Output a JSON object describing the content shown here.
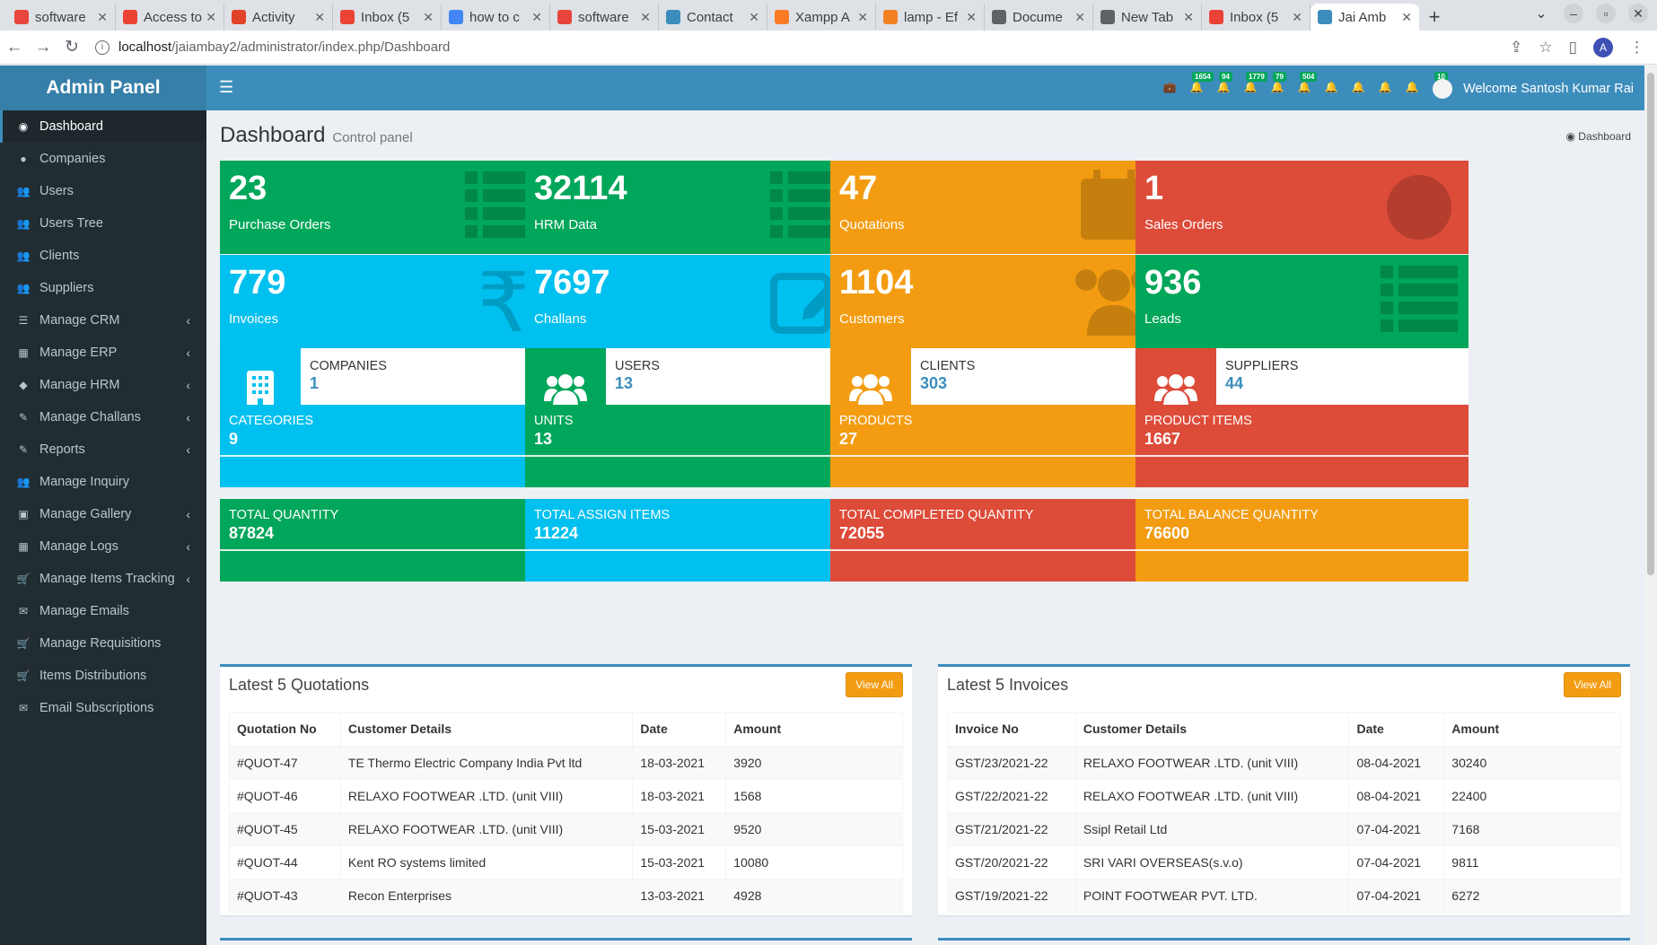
{
  "browser": {
    "tabs": [
      {
        "label": "software",
        "color": "#e8453c"
      },
      {
        "label": "Access to",
        "color": "#ea4335"
      },
      {
        "label": "Activity",
        "color": "#e24329"
      },
      {
        "label": "Inbox (5",
        "color": "#ea4335"
      },
      {
        "label": "how to c",
        "color": "#4285f4"
      },
      {
        "label": "software",
        "color": "#e8453c"
      },
      {
        "label": "Contact",
        "color": "#3c8dbc"
      },
      {
        "label": "Xampp A",
        "color": "#fb7a24"
      },
      {
        "label": "lamp - Ef",
        "color": "#f48024"
      },
      {
        "label": "Docume",
        "color": "#5f6368"
      },
      {
        "label": "New Tab",
        "color": "#5f6368"
      },
      {
        "label": "Inbox (5",
        "color": "#ea4335"
      },
      {
        "label": "Jai Amb",
        "color": "#3c8dbc"
      }
    ],
    "url_host": "localhost",
    "url_path": "/jaiambay2/administrator/index.php/Dashboard",
    "profile_initial": "A"
  },
  "brand": "Admin Panel",
  "sidebar": {
    "items": [
      {
        "label": "Dashboard",
        "icon": "dashboard-icon",
        "glyph": "◉",
        "arrow": ""
      },
      {
        "label": "Companies",
        "icon": "globe-icon",
        "glyph": "●",
        "arrow": ""
      },
      {
        "label": "Users",
        "icon": "users-icon",
        "glyph": "👥",
        "arrow": ""
      },
      {
        "label": "Users Tree",
        "icon": "users-icon",
        "glyph": "👥",
        "arrow": ""
      },
      {
        "label": "Clients",
        "icon": "users-icon",
        "glyph": "👥",
        "arrow": ""
      },
      {
        "label": "Suppliers",
        "icon": "users-icon",
        "glyph": "👥",
        "arrow": ""
      },
      {
        "label": "Manage CRM",
        "icon": "list-icon",
        "glyph": "☰",
        "arrow": "‹"
      },
      {
        "label": "Manage ERP",
        "icon": "film-icon",
        "glyph": "▦",
        "arrow": "‹"
      },
      {
        "label": "Manage HRM",
        "icon": "tags-icon",
        "glyph": "◆",
        "arrow": "‹"
      },
      {
        "label": "Manage Challans",
        "icon": "edit-icon",
        "glyph": "✎",
        "arrow": "‹"
      },
      {
        "label": "Reports",
        "icon": "edit-icon",
        "glyph": "✎",
        "arrow": "‹"
      },
      {
        "label": "Manage Inquiry",
        "icon": "users-icon",
        "glyph": "👥",
        "arrow": ""
      },
      {
        "label": "Manage Gallery",
        "icon": "image-icon",
        "glyph": "▣",
        "arrow": "‹"
      },
      {
        "label": "Manage Logs",
        "icon": "calendar-icon",
        "glyph": "▦",
        "arrow": "‹"
      },
      {
        "label": "Manage Items Tracking",
        "icon": "cart-icon",
        "glyph": "🛒",
        "arrow": "‹"
      },
      {
        "label": "Manage Emails",
        "icon": "envelope-icon",
        "glyph": "✉",
        "arrow": ""
      },
      {
        "label": "Manage Requisitions",
        "icon": "cart-icon",
        "glyph": "🛒",
        "arrow": ""
      },
      {
        "label": "Items Distributions",
        "icon": "cart-icon",
        "glyph": "🛒",
        "arrow": ""
      },
      {
        "label": "Email Subscriptions",
        "icon": "envelope-icon",
        "glyph": "✉",
        "arrow": ""
      }
    ]
  },
  "topnav": {
    "notifications": [
      {
        "icon": "briefcase-icon",
        "glyph": "💼",
        "badge": ""
      },
      {
        "icon": "bell-icon",
        "glyph": "🔔",
        "badge": "1654"
      },
      {
        "icon": "bell-icon",
        "glyph": "🔔",
        "badge": "94"
      },
      {
        "icon": "bell-icon",
        "glyph": "🔔",
        "badge": "1779"
      },
      {
        "icon": "bell-icon",
        "glyph": "🔔",
        "badge": "79"
      },
      {
        "icon": "bell-icon",
        "glyph": "🔔",
        "badge": "504"
      },
      {
        "icon": "bell-icon",
        "glyph": "🔔",
        "badge": ""
      },
      {
        "icon": "bell-icon",
        "glyph": "🔔",
        "badge": ""
      },
      {
        "icon": "bell-icon",
        "glyph": "🔔",
        "badge": ""
      },
      {
        "icon": "bell-icon",
        "glyph": "🔔",
        "badge": ""
      },
      {
        "icon": "envelope-icon",
        "glyph": "✉",
        "badge": "10"
      }
    ],
    "welcome": "Welcome Santosh Kumar Rai"
  },
  "header": {
    "title": "Dashboard",
    "subtitle": "Control panel",
    "breadcrumb": "Dashboard"
  },
  "small_boxes": [
    {
      "value": "23",
      "label": "Purchase Orders",
      "color": "green",
      "icon": "list-icon"
    },
    {
      "value": "32114",
      "label": "HRM Data",
      "color": "green",
      "icon": "list-icon"
    },
    {
      "value": "47",
      "label": "Quotations",
      "color": "yellow",
      "icon": "calendar-icon"
    },
    {
      "value": "1",
      "label": "Sales Orders",
      "color": "red",
      "icon": "pie-chart-icon"
    },
    {
      "value": "779",
      "label": "Invoices",
      "color": "aqua",
      "icon": "rupee-icon"
    },
    {
      "value": "7697",
      "label": "Challans",
      "color": "aqua",
      "icon": "edit-icon"
    },
    {
      "value": "1104",
      "label": "Customers",
      "color": "yellow",
      "icon": "users-icon"
    },
    {
      "value": "936",
      "label": "Leads",
      "color": "green",
      "icon": "list-icon"
    }
  ],
  "info_boxes": [
    {
      "text": "COMPANIES",
      "value": "1",
      "color": "aqua",
      "icon": "building-icon"
    },
    {
      "text": "USERS",
      "value": "13",
      "color": "green",
      "icon": "users-icon"
    },
    {
      "text": "CLIENTS",
      "value": "303",
      "color": "yellow",
      "icon": "users-icon"
    },
    {
      "text": "SUPPLIERS",
      "value": "44",
      "color": "red",
      "icon": "users-icon"
    }
  ],
  "color_boxes": [
    {
      "text": "CATEGORIES",
      "value": "9",
      "color": "aqua"
    },
    {
      "text": "UNITS",
      "value": "13",
      "color": "green"
    },
    {
      "text": "PRODUCTS",
      "value": "27",
      "color": "yellow"
    },
    {
      "text": "PRODUCT ITEMS",
      "value": "1667",
      "color": "red"
    },
    {
      "text": "TOTAL QUANTITY",
      "value": "87824",
      "color": "green"
    },
    {
      "text": "TOTAL ASSIGN ITEMS",
      "value": "11224",
      "color": "aqua"
    },
    {
      "text": "TOTAL COMPLETED QUANTITY",
      "value": "72055",
      "color": "red"
    },
    {
      "text": "TOTAL BALANCE QUANTITY",
      "value": "76600",
      "color": "yellow"
    }
  ],
  "quotations": {
    "title": "Latest 5 Quotations",
    "view_all": "View All",
    "columns": [
      "Quotation No",
      "Customer Details",
      "Date",
      "Amount"
    ],
    "rows": [
      [
        "#QUOT-47",
        "TE Thermo Electric Company India Pvt ltd",
        "18-03-2021",
        "3920"
      ],
      [
        "#QUOT-46",
        "RELAXO FOOTWEAR .LTD. (unit VIII)",
        "18-03-2021",
        "1568"
      ],
      [
        "#QUOT-45",
        "RELAXO FOOTWEAR .LTD. (unit VIII)",
        "15-03-2021",
        "9520"
      ],
      [
        "#QUOT-44",
        "Kent RO systems limited",
        "15-03-2021",
        "10080"
      ],
      [
        "#QUOT-43",
        "Recon Enterprises",
        "13-03-2021",
        "4928"
      ]
    ]
  },
  "invoices": {
    "title": "Latest 5 Invoices",
    "view_all": "View All",
    "columns": [
      "Invoice No",
      "Customer Details",
      "Date",
      "Amount"
    ],
    "rows": [
      [
        "GST/23/2021-22",
        "RELAXO FOOTWEAR .LTD. (unit VIII)",
        "08-04-2021",
        "30240"
      ],
      [
        "GST/22/2021-22",
        "RELAXO FOOTWEAR .LTD. (unit VIII)",
        "08-04-2021",
        "22400"
      ],
      [
        "GST/21/2021-22",
        "Ssipl Retail Ltd",
        "07-04-2021",
        "7168"
      ],
      [
        "GST/20/2021-22",
        "SRI VARI OVERSEAS(s.v.o)",
        "07-04-2021",
        "9811"
      ],
      [
        "GST/19/2021-22",
        "POINT FOOTWEAR PVT. LTD.",
        "07-04-2021",
        "6272"
      ]
    ]
  }
}
